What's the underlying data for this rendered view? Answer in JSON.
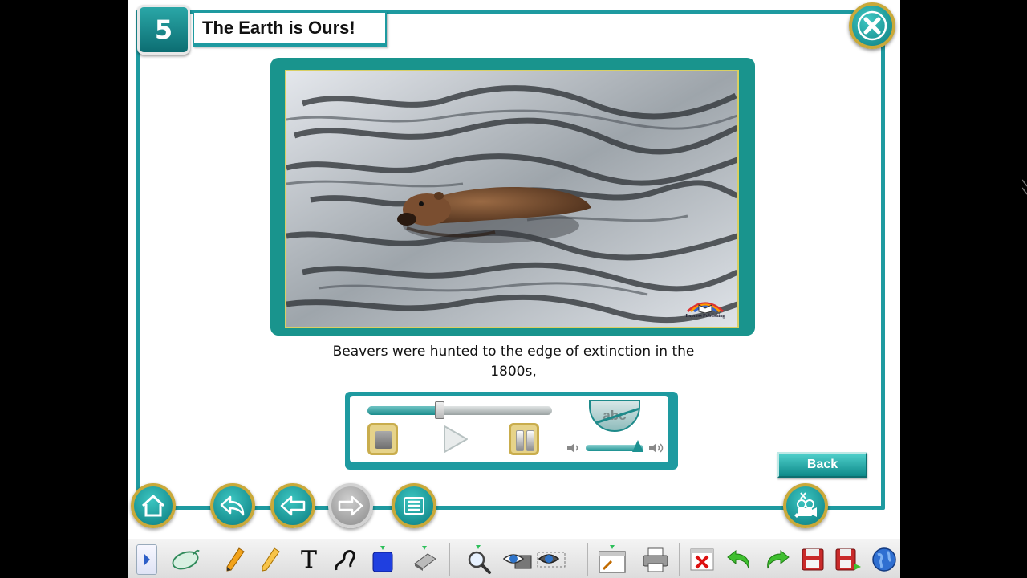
{
  "header": {
    "unit_number": "5",
    "title": "The Earth is Ours!"
  },
  "video": {
    "publisher": "Express Publishing"
  },
  "caption": {
    "line1": "Beavers were hunted to the edge of extinction in the",
    "line2": "1800s,"
  },
  "player": {
    "progress": 0.39,
    "volume": 0.9,
    "subtitles_label": "abc"
  },
  "back_button": {
    "label": "Back"
  },
  "colors": {
    "teal": "#1e9aa0",
    "gold": "#c9a93a",
    "background": "#ffffff"
  },
  "nav_buttons": [
    "home-icon",
    "undo-arrow-icon",
    "previous-arrow-icon",
    "next-arrow-icon",
    "menu-list-icon"
  ],
  "toolbar_items": [
    "expand-arrow-icon",
    "mouse-icon",
    "pencil-icon",
    "highlighter-icon",
    "text-tool-icon",
    "freehand-line-icon",
    "shape-fill-icon",
    "eraser-icon",
    "magnifier-icon",
    "reveal-eye-icon",
    "hide-eye-icon",
    "whiteboard-icon",
    "printer-icon",
    "clear-icon",
    "undo-icon",
    "redo-icon",
    "save-icon",
    "save-as-icon",
    "globe-icon"
  ],
  "toolbar": {
    "text_tool_label": "T"
  }
}
